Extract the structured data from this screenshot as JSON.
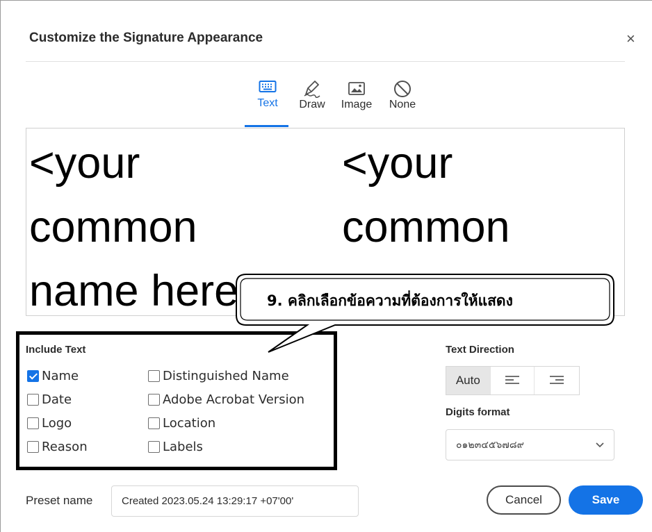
{
  "dialog": {
    "title": "Customize the Signature Appearance",
    "close_label": "×"
  },
  "tabs": [
    {
      "label": "Text",
      "icon": "keyboard-icon",
      "active": true
    },
    {
      "label": "Draw",
      "icon": "pen-icon",
      "active": false
    },
    {
      "label": "Image",
      "icon": "image-icon",
      "active": false
    },
    {
      "label": "None",
      "icon": "none-icon",
      "active": false
    }
  ],
  "preview": {
    "left_text": "<your\ncommon\nname here>",
    "right_text": "<your\ncommon\nname here>"
  },
  "callout": {
    "text": "9. คลิกเลือกข้อความที่ต้องการให้แสดง"
  },
  "include_text": {
    "label": "Include Text",
    "options": [
      {
        "label": "Name",
        "checked": true
      },
      {
        "label": "Distinguished Name",
        "checked": false
      },
      {
        "label": "Date",
        "checked": false
      },
      {
        "label": "Adobe Acrobat Version",
        "checked": false
      },
      {
        "label": "Logo",
        "checked": false
      },
      {
        "label": "Location",
        "checked": false
      },
      {
        "label": "Reason",
        "checked": false
      },
      {
        "label": "Labels",
        "checked": false
      }
    ]
  },
  "text_direction": {
    "label": "Text Direction",
    "options": [
      {
        "label": "Auto",
        "selected": true
      },
      {
        "label": "",
        "icon": "align-left-icon",
        "selected": false
      },
      {
        "label": "",
        "icon": "align-right-icon",
        "selected": false
      }
    ]
  },
  "digits_format": {
    "label": "Digits format",
    "selected": "๐๑๒๓๔๕๖๗๘๙"
  },
  "preset": {
    "label": "Preset name",
    "value": "Created 2023.05.24 13:29:17 +07'00'"
  },
  "buttons": {
    "cancel": "Cancel",
    "save": "Save"
  },
  "colors": {
    "accent": "#1473e6",
    "text": "#2c2c2c",
    "callout_border": "#000000"
  }
}
